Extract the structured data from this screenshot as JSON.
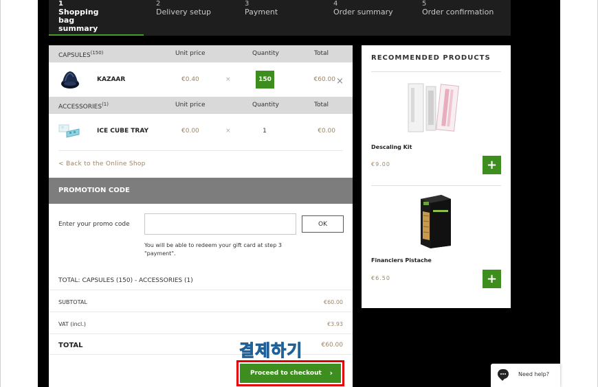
{
  "steps": [
    {
      "num": "1",
      "label": "Shopping bag summary",
      "active": true
    },
    {
      "num": "2",
      "label": "Delivery setup"
    },
    {
      "num": "3",
      "label": "Payment"
    },
    {
      "num": "4",
      "label": "Order summary"
    },
    {
      "num": "5",
      "label": "Order confirmation"
    }
  ],
  "capsules": {
    "header": {
      "label": "CAPSULES",
      "count": "(150)",
      "unit_price": "Unit price",
      "quantity": "Quantity",
      "total": "Total"
    },
    "item": {
      "name": "KAZAAR",
      "unit_price": "€0.40",
      "times": "×",
      "quantity": "150",
      "total": "€60.00",
      "remove": "×"
    }
  },
  "accessories": {
    "header": {
      "label": "ACCESSORIES",
      "count": "(1)",
      "unit_price": "Unit price",
      "quantity": "Quantity",
      "total": "Total"
    },
    "item": {
      "name": "ICE CUBE TRAY",
      "unit_price": "€0.00",
      "times": "×",
      "quantity": "1",
      "total": "€0.00"
    }
  },
  "back_link": "< Back to the Online Shop",
  "promo": {
    "title": "PROMOTION CODE",
    "label": "Enter your promo code",
    "input_value": "",
    "ok": "OK",
    "note": "You will be able to redeem your gift card at step 3 \"payment\"."
  },
  "totals": {
    "summary": "TOTAL: CAPSULES (150) - ACCESSORIES (1)",
    "subtotal_label": "SUBTOTAL",
    "subtotal": "€60.00",
    "vat_label": "VAT (incl.)",
    "vat": "€3.93",
    "total_label": "TOTAL",
    "total": "€60.00"
  },
  "annotation": "결제하기",
  "checkout": {
    "label": "Proceed to checkout",
    "chevron": "›"
  },
  "recommended": {
    "title": "RECOMMENDED PRODUCTS",
    "items": [
      {
        "name": "Descaling Kit",
        "price": "€9.00",
        "add": "+"
      },
      {
        "name": "Financiers Pistache",
        "price": "€6.50",
        "add": "+"
      }
    ]
  },
  "help": {
    "label": "Need help?"
  },
  "colors": {
    "accent_green": "#3e8e1f",
    "price_brown": "#9b8466",
    "highlight_red": "#e00000",
    "annotation_blue": "#3f95d0"
  }
}
